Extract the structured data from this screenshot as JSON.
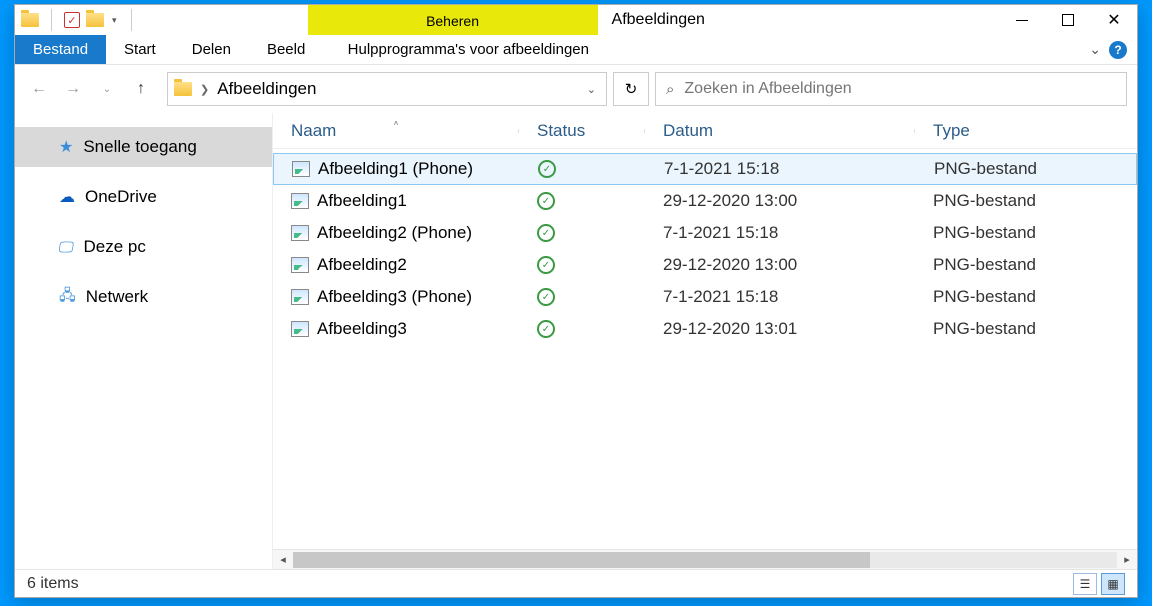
{
  "window": {
    "title": "Afbeeldingen",
    "context_tab_top": "Beheren",
    "context_tab_bottom": "Hulpprogramma's voor afbeeldingen"
  },
  "ribbon": {
    "file": "Bestand",
    "tabs": [
      "Start",
      "Delen",
      "Beeld"
    ]
  },
  "address": {
    "current": "Afbeeldingen"
  },
  "search": {
    "placeholder": "Zoeken in Afbeeldingen"
  },
  "sidebar": {
    "items": [
      {
        "label": "Snelle toegang",
        "icon": "star",
        "selected": true
      },
      {
        "label": "OneDrive",
        "icon": "cloud",
        "selected": false
      },
      {
        "label": "Deze pc",
        "icon": "pc",
        "selected": false
      },
      {
        "label": "Netwerk",
        "icon": "net",
        "selected": false
      }
    ]
  },
  "columns": {
    "name": "Naam",
    "status": "Status",
    "date": "Datum",
    "type": "Type"
  },
  "files": [
    {
      "name": "Afbeelding1 (Phone)",
      "status": "ok",
      "date": "7-1-2021 15:18",
      "type": "PNG-bestand",
      "selected": true
    },
    {
      "name": "Afbeelding1",
      "status": "ok",
      "date": "29-12-2020 13:00",
      "type": "PNG-bestand",
      "selected": false
    },
    {
      "name": "Afbeelding2 (Phone)",
      "status": "ok",
      "date": "7-1-2021 15:18",
      "type": "PNG-bestand",
      "selected": false
    },
    {
      "name": "Afbeelding2",
      "status": "ok",
      "date": "29-12-2020 13:00",
      "type": "PNG-bestand",
      "selected": false
    },
    {
      "name": "Afbeelding3 (Phone)",
      "status": "ok",
      "date": "7-1-2021 15:18",
      "type": "PNG-bestand",
      "selected": false
    },
    {
      "name": "Afbeelding3",
      "status": "ok",
      "date": "29-12-2020 13:01",
      "type": "PNG-bestand",
      "selected": false
    }
  ],
  "statusbar": {
    "count": "6 items"
  }
}
